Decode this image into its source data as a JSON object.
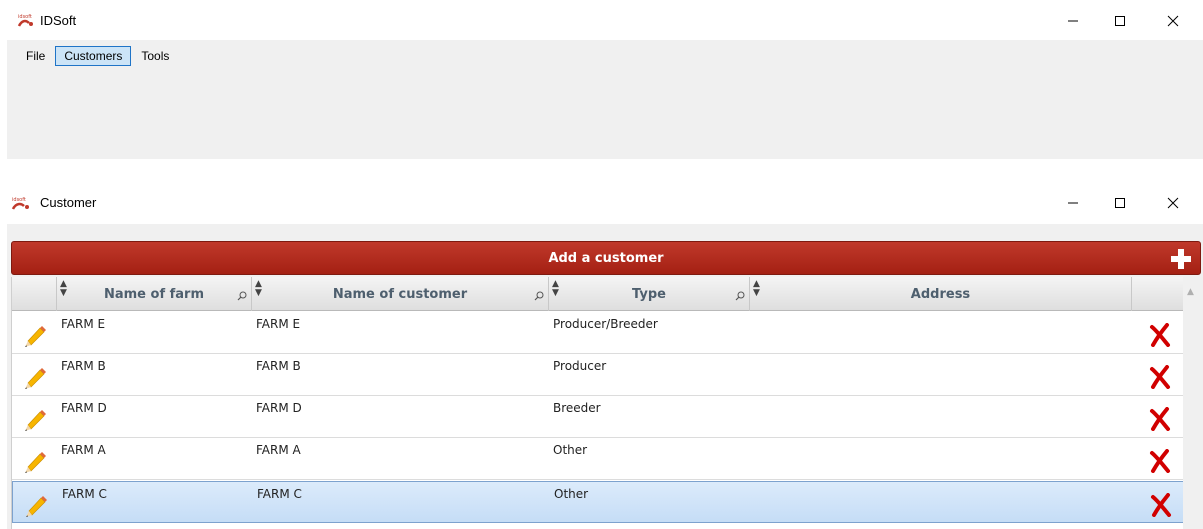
{
  "main_window": {
    "title": "IDSoft",
    "menu": [
      {
        "label": "File",
        "active": false
      },
      {
        "label": "Customers",
        "active": true
      },
      {
        "label": "Tools",
        "active": false
      }
    ]
  },
  "customer_window": {
    "title": "Customer",
    "add_button_label": "Add a customer",
    "columns": [
      "Name of farm",
      "Name of customer",
      "Type",
      "Address"
    ],
    "rows": [
      {
        "farm": "FARM E",
        "customer": "FARM E",
        "type": "Producer/Breeder",
        "address": "",
        "selected": false
      },
      {
        "farm": "FARM B",
        "customer": "FARM B",
        "type": "Producer",
        "address": "",
        "selected": false
      },
      {
        "farm": "FARM D",
        "customer": "FARM D",
        "type": "Breeder",
        "address": "",
        "selected": false
      },
      {
        "farm": "FARM A",
        "customer": "FARM A",
        "type": "Other",
        "address": "",
        "selected": false
      },
      {
        "farm": "FARM C",
        "customer": "FARM C",
        "type": "Other",
        "address": "",
        "selected": true
      }
    ]
  },
  "icons": [
    "app-logo-icon",
    "minimize-icon",
    "maximize-icon",
    "close-icon",
    "plus-icon",
    "sort-icon",
    "filter-icon",
    "pencil-icon",
    "delete-x-icon"
  ],
  "colors": {
    "accent_red": "#b0281a",
    "menu_active": "#cce4f7",
    "header_text": "#4e5f6e",
    "selected_row": "#cde1f7"
  }
}
